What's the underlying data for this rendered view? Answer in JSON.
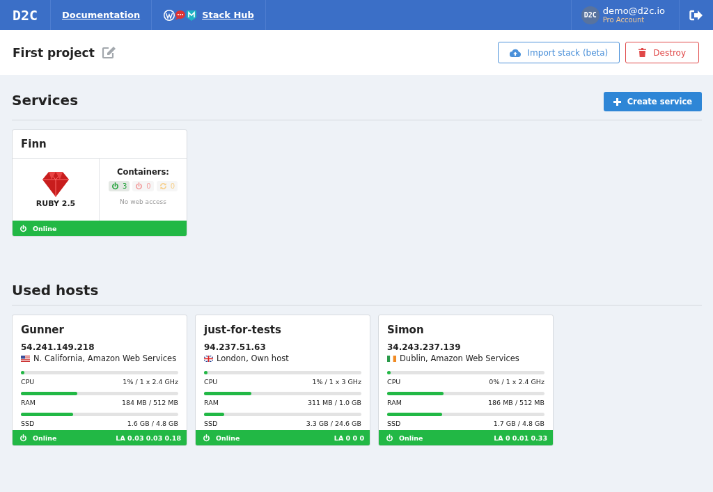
{
  "navbar": {
    "logo": "D2C",
    "links": [
      {
        "label": "Documentation",
        "kind": "doc"
      },
      {
        "label": "Stack Hub",
        "kind": "hub"
      }
    ],
    "user": {
      "avatar": "D2C",
      "email": "demo@d2c.io",
      "plan": "Pro Account"
    }
  },
  "project": {
    "title": "First project",
    "buttons": [
      {
        "label": "Import stack (beta)",
        "kind": "import"
      },
      {
        "label": "Destroy",
        "kind": "destroy"
      }
    ]
  },
  "services": {
    "title": "Services",
    "create_button": "Create service",
    "items": [
      {
        "name": "Finn",
        "runtime": "RUBY 2.5",
        "containers_label": "Containers:",
        "counters": [
          {
            "kind": "running",
            "count": "3"
          },
          {
            "kind": "stopped",
            "count": "0"
          },
          {
            "kind": "restarting",
            "count": "0"
          }
        ],
        "access": "No web access",
        "online": true,
        "status": "Online"
      }
    ]
  },
  "hosts": {
    "title": "Used hosts",
    "items": [
      {
        "name": "Gunner",
        "ip": "54.241.149.218",
        "kind": "us",
        "location": "N. California, Amazon Web Services",
        "metrics": [
          {
            "label": "CPU",
            "value": "1% / 1 x 2.4 GHz",
            "level": 0.01
          },
          {
            "label": "RAM",
            "value": "184 MB / 512 MB",
            "level": 0.36
          },
          {
            "label": "SSD",
            "value": "1.6 GB / 4.8 GB",
            "level": 0.33
          }
        ],
        "online": true,
        "status": "Online",
        "load": "LA 0.03 0.03 0.18"
      },
      {
        "name": "just-for-tests",
        "ip": "94.237.51.63",
        "kind": "gb",
        "location": "London, Own host",
        "metrics": [
          {
            "label": "CPU",
            "value": "1% / 1 x 3 GHz",
            "level": 0.01
          },
          {
            "label": "RAM",
            "value": "311 MB / 1.0 GB",
            "level": 0.3
          },
          {
            "label": "SSD",
            "value": "3.3 GB / 24.6 GB",
            "level": 0.13
          }
        ],
        "online": true,
        "status": "Online",
        "load": "LA 0 0 0"
      },
      {
        "name": "Simon",
        "ip": "34.243.237.139",
        "kind": "ie",
        "location": "Dublin, Amazon Web Services",
        "metrics": [
          {
            "label": "CPU",
            "value": "0% / 1 x 2.4 GHz",
            "level": 0
          },
          {
            "label": "RAM",
            "value": "186 MB / 512 MB",
            "level": 0.36
          },
          {
            "label": "SSD",
            "value": "1.7 GB / 4.8 GB",
            "level": 0.35
          }
        ],
        "online": true,
        "status": "Online",
        "load": "LA 0 0.01 0.33"
      }
    ]
  }
}
